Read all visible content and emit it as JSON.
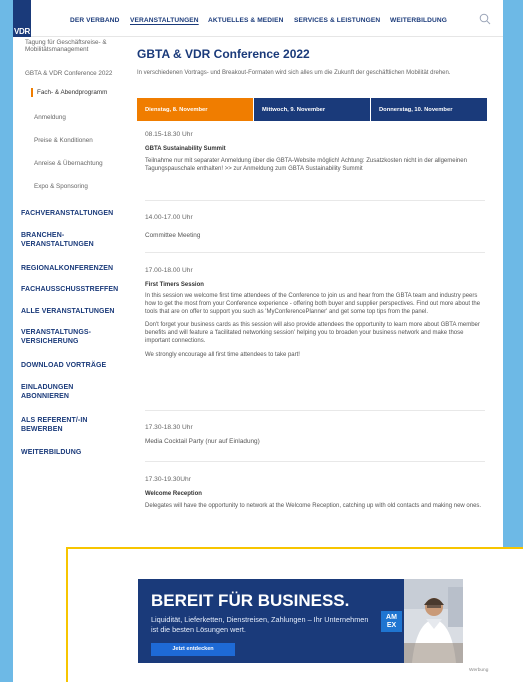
{
  "logo": {
    "text": "VDR"
  },
  "topnav": {
    "items": [
      "DER VERBAND",
      "VERANSTALTUNGEN",
      "AKTUELLES & MEDIEN",
      "SERVICES & LEISTUNGEN",
      "WEITERBILDUNG"
    ],
    "active": "VERANSTALTUNGEN"
  },
  "sidebar": {
    "sub_items": [
      "Tagung für Geschäftsreise- &",
      "Mobilitätsmanagement",
      "GBTA & VDR Conference 2022",
      "Fach- & Abendprogramm",
      "Anmeldung",
      "Preise & Konditionen",
      "Anreise & Übernachtung",
      "Expo & Sponsoring"
    ],
    "categories": [
      "FACHVERANSTALTUNGEN",
      "BRANCHEN-",
      "VERANSTALTUNGEN",
      "REGIONALKONFERENZEN",
      "FACHAUSSCHUSSTREFFEN",
      "ALLE VERANSTALTUNGEN",
      "VERANSTALTUNGS-",
      "VERSICHERUNG",
      "DOWNLOAD VORTRÄGE",
      "EINLADUNGEN",
      "ABONNIEREN",
      "ALS REFERENT/-IN",
      "BEWERBEN",
      "WEITERBILDUNG"
    ]
  },
  "main": {
    "title": "GBTA & VDR Conference 2022",
    "intro": "In verschiedenen Vortrags- und Breakout-Formaten wird sich alles um die Zukunft der geschäftlichen Mobilität drehen.",
    "tabs": [
      "Dienstag, 8. November",
      "Mittwoch, 9. November",
      "Donnerstag, 10. November"
    ],
    "sessions": [
      {
        "time": "08.15-18.30 Uhr",
        "title": "GBTA Sustainability Summit",
        "desc": "Teilnahme nur mit separater Anmeldung über die GBTA-Website möglich! Achtung: Zusatzkosten nicht in der allgemeinen Tagungspauschale enthalten! >> zur Anmeldung zum GBTA Sustainability Summit"
      },
      {
        "time": "14.00-17.00 Uhr",
        "title": "Committee Meeting"
      },
      {
        "time": "17.00-18.00 Uhr",
        "title": "First Timers Session",
        "p1": "In this session we welcome first time attendees of the Conference to join us and hear from the GBTA team and industry peers how to get the most from your Conference experience - offering both buyer and supplier perspectives. Find out more about the tools that are on offer to support you such as 'MyConferencePlanner' and get some top tips from the panel.",
        "p2": "Don't forget your business cards as this session will also provide attendees the opportunity to learn more about GBTA member benefits and will feature a 'facilitated networking session' helping you to broaden your business network and make those important connections.",
        "p3": "We strongly encourage all first time attendees to take part!"
      },
      {
        "time": "17.30-18.30 Uhr",
        "title": "Media Cocktail Party (nur auf Einladung)"
      },
      {
        "time": "17.30-19.30Uhr",
        "title": "Welcome Reception",
        "desc": "Delegates will have the opportunity to network at the Welcome Reception, catching up with old contacts and making new ones."
      }
    ]
  },
  "ad": {
    "headline": "BEREIT FÜR BUSINESS.",
    "sub": "Liquidität, Lieferketten, Dienstreisen, Zahlungen – Ihr Unternehmen ist die besten Lösungen wert.",
    "button": "Jetzt entdecken",
    "amex": "AM EX",
    "label": "Werbung"
  },
  "colors": {
    "navy": "#1a3a7a",
    "orange": "#f07d00",
    "yellow": "#f7c500",
    "background": "#6db9e6"
  }
}
